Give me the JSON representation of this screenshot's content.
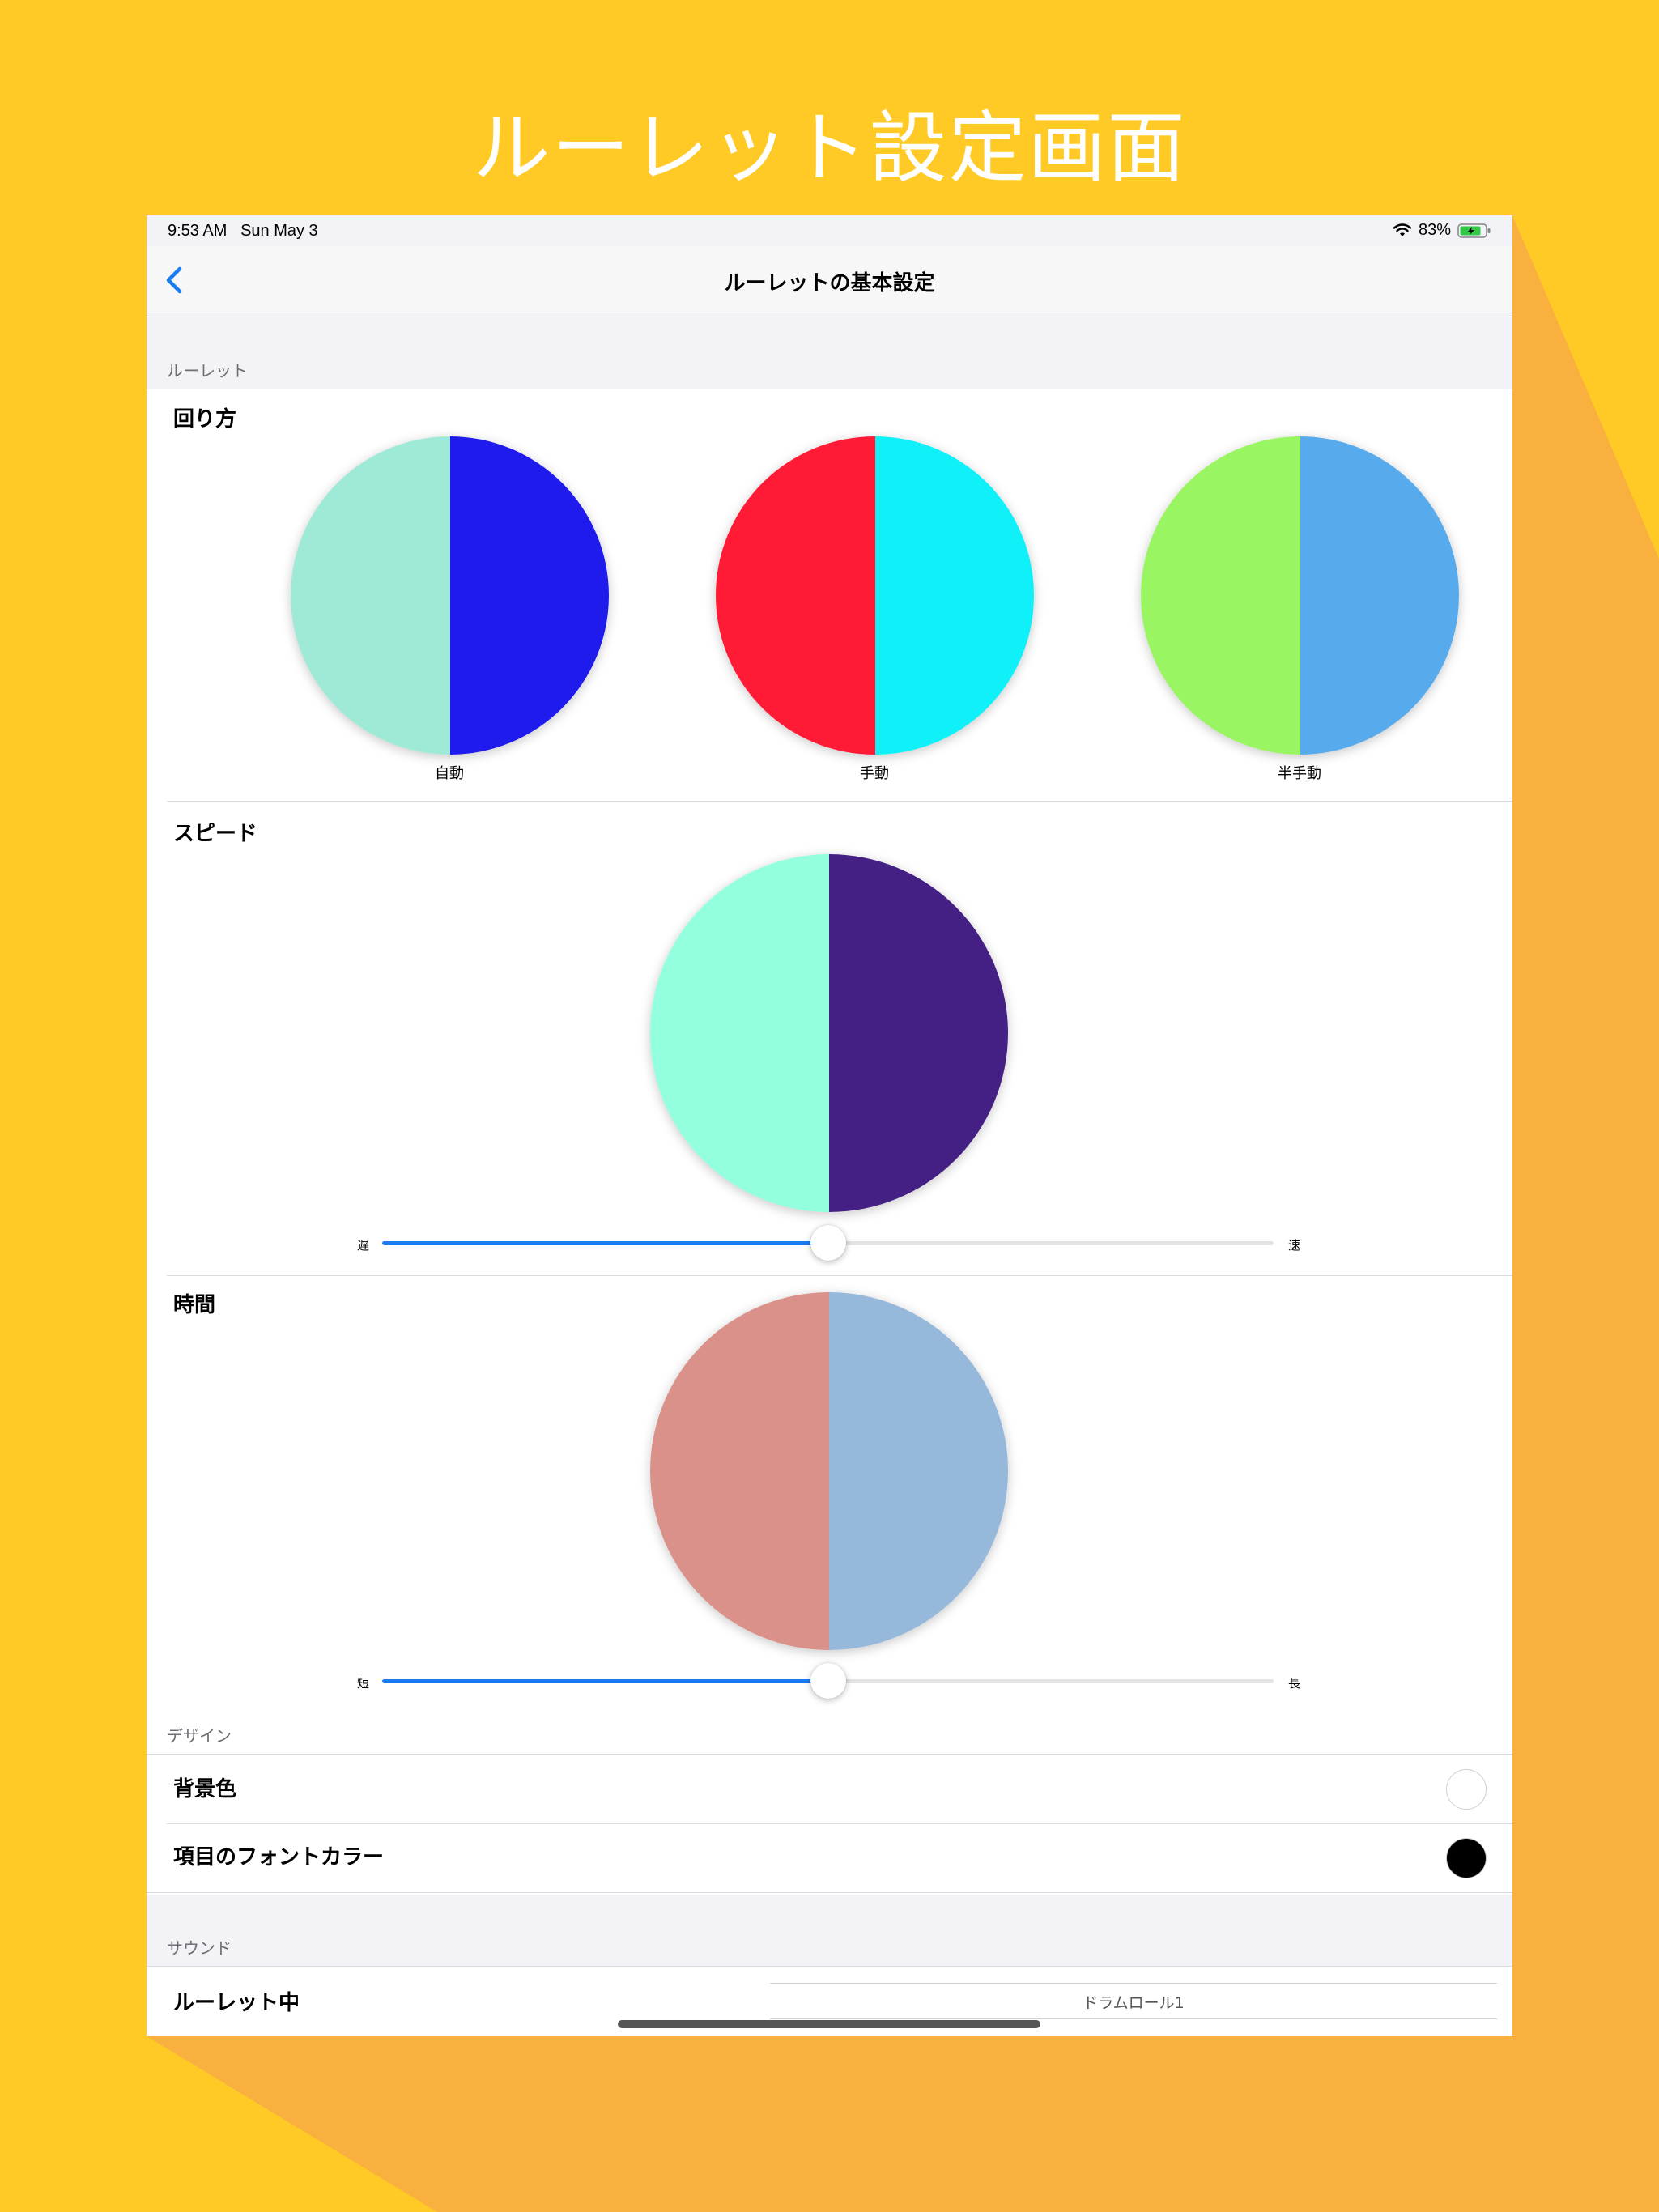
{
  "headline": "ルーレット設定画面",
  "status": {
    "time": "9:53 AM",
    "date": "Sun May 3",
    "battery": "83%"
  },
  "nav": {
    "title": "ルーレットの基本設定"
  },
  "sections": {
    "roulette": {
      "header": "ルーレット",
      "spin_label": "回り方",
      "spin_modes": [
        {
          "caption": "自動",
          "left_color": "#9FEAD6",
          "right_color": "#1F1BEC"
        },
        {
          "caption": "手動",
          "left_color": "#FF1A35",
          "right_color": "#10F0F8"
        },
        {
          "caption": "半手動",
          "left_color": "#99F562",
          "right_color": "#57AAEC"
        }
      ],
      "speed": {
        "label": "スピード",
        "min_label": "遅",
        "max_label": "速",
        "value": 0.5,
        "left_color": "#93FFDF",
        "right_color": "#452084"
      },
      "time": {
        "label": "時間",
        "min_label": "短",
        "max_label": "長",
        "value": 0.5,
        "left_color": "#DA918A",
        "right_color": "#96B8DA"
      }
    },
    "design": {
      "header": "デザイン",
      "background_label": "背景色",
      "background_color": "#FFFFFF",
      "font_color_label": "項目のフォントカラー",
      "font_color": "#000000"
    },
    "sound": {
      "header": "サウンド",
      "during_label": "ルーレット中",
      "during_value": "ドラムロール1"
    }
  },
  "colors": {
    "page_bg": "#FFCA25",
    "accent_shape": "#FAB03E",
    "tint": "#1A7CF0"
  },
  "icons": [
    "back-chevron-icon",
    "wifi-icon",
    "battery-icon"
  ]
}
